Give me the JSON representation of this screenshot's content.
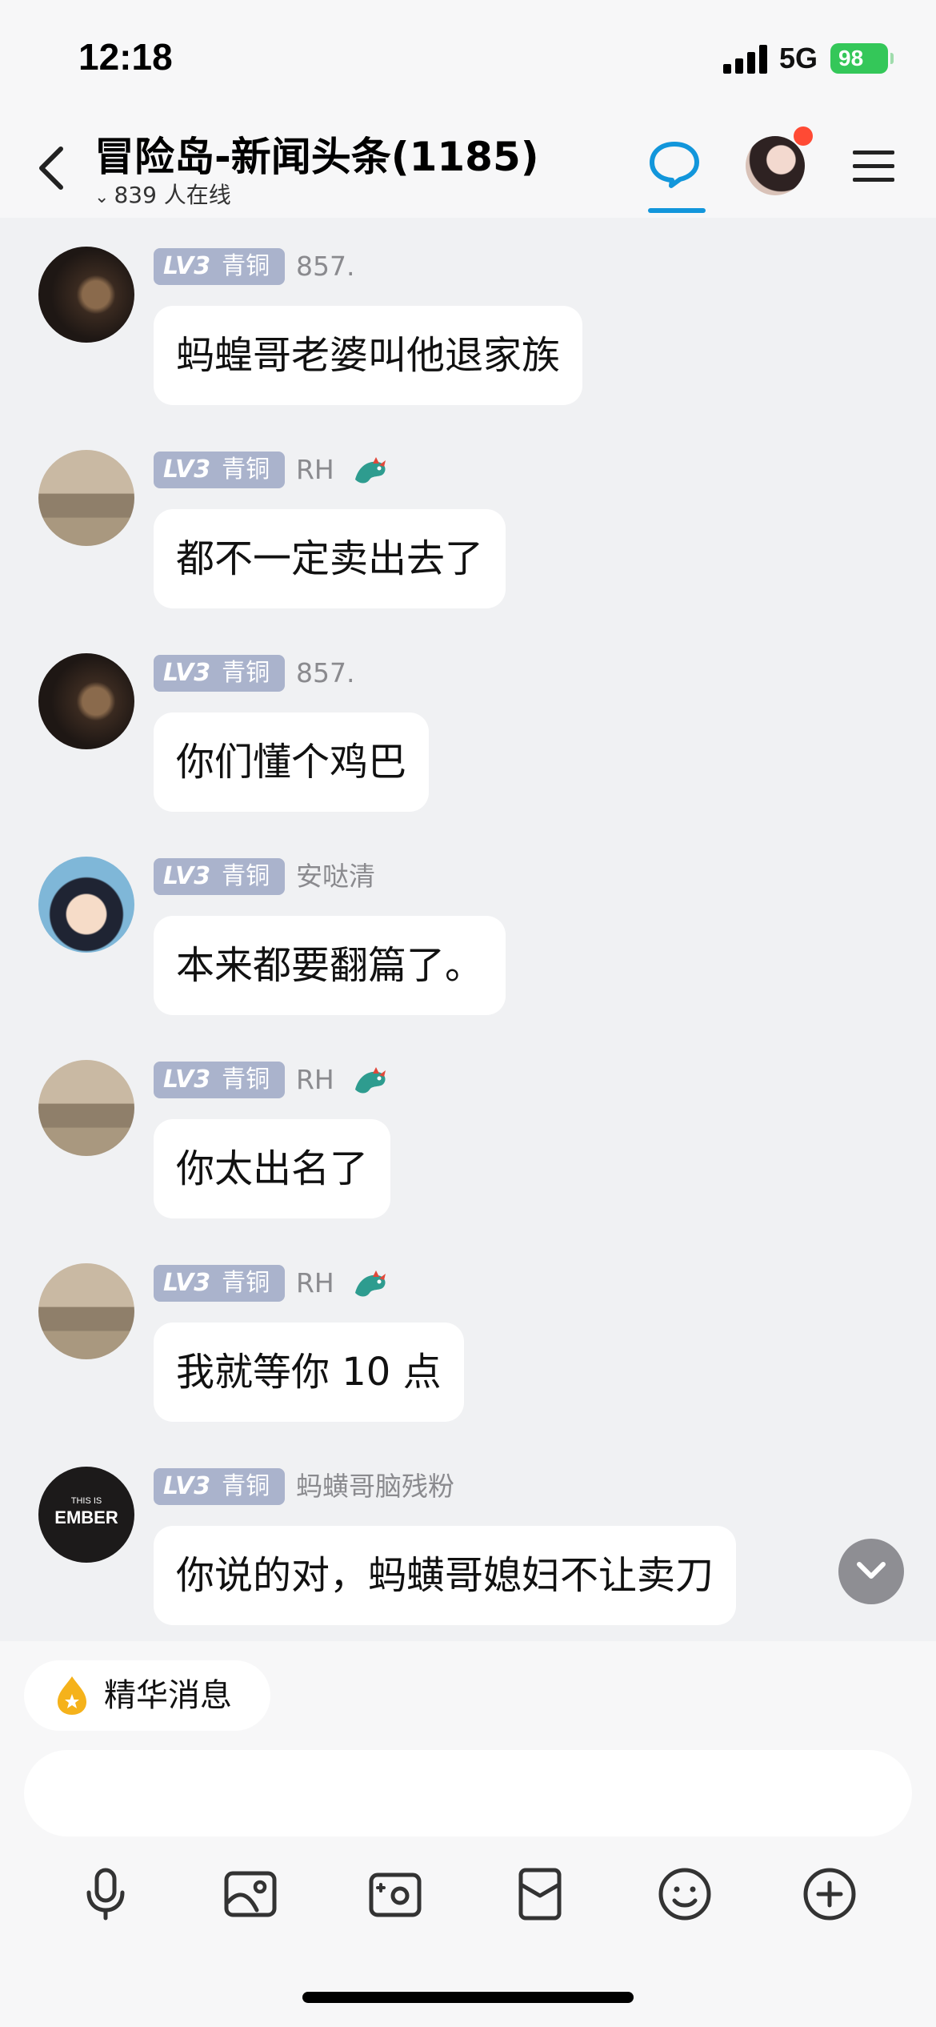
{
  "status_bar": {
    "time": "12:18",
    "network": "5G",
    "battery": "98",
    "battery_color": "#34c759"
  },
  "header": {
    "title": "冒险岛-新闻头条(1185)",
    "online_count": "839 人在线",
    "accent_color": "#1296db",
    "notification_dot_color": "#ff4a34"
  },
  "messages": [
    {
      "level": "LV3",
      "rank": "青铜",
      "nickname": "857.",
      "text": "蚂蝗哥老婆叫他退家族",
      "avatar": "dark-avatar",
      "badge_icon": null
    },
    {
      "level": "LV3",
      "rank": "青铜",
      "nickname": "RH",
      "text": "都不一定卖出去了",
      "avatar": "sepia-avatar",
      "badge_icon": "dragon-icon"
    },
    {
      "level": "LV3",
      "rank": "青铜",
      "nickname": "857.",
      "text": "你们懂个鸡巴",
      "avatar": "dark-avatar",
      "badge_icon": null
    },
    {
      "level": "LV3",
      "rank": "青铜",
      "nickname": "安哒清",
      "text": "本来都要翻篇了。",
      "avatar": "anime-avatar",
      "badge_icon": null
    },
    {
      "level": "LV3",
      "rank": "青铜",
      "nickname": "RH",
      "text": "你太出名了",
      "avatar": "sepia-avatar",
      "badge_icon": "dragon-icon"
    },
    {
      "level": "LV3",
      "rank": "青铜",
      "nickname": "RH",
      "text": "我就等你 10 点",
      "avatar": "sepia-avatar",
      "badge_icon": "dragon-icon"
    },
    {
      "level": "LV3",
      "rank": "青铜",
      "nickname": "蚂蟥哥脑残粉",
      "text": "你说的对，蚂蟥哥媳妇不让卖刀",
      "avatar": "ember-avatar",
      "badge_icon": null
    }
  ],
  "ember_avatar": {
    "line1": "THIS IS",
    "line2": "EMBER"
  },
  "bottom": {
    "essence_label": "精华消息",
    "input_placeholder": "",
    "toolbar_icons": [
      "microphone-icon",
      "image-icon",
      "camera-icon",
      "red-packet-icon",
      "emoji-icon",
      "plus-icon"
    ]
  }
}
